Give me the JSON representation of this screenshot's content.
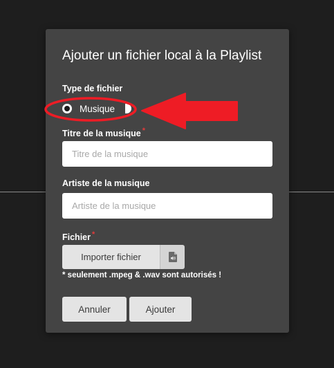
{
  "dialog": {
    "title": "Ajouter un fichier local à la Playlist",
    "file_type": {
      "label": "Type de fichier",
      "options": [
        {
          "label": "Musique",
          "selected": true
        },
        {
          "label": "",
          "selected": false
        }
      ]
    },
    "music_title": {
      "label": "Titre de la musique",
      "required_mark": "*",
      "placeholder": "Titre de la musique",
      "value": ""
    },
    "music_artist": {
      "label": "Artiste de la musique",
      "placeholder": "Artiste de la musique",
      "value": ""
    },
    "file": {
      "label": "Fichier",
      "required_mark": "*",
      "import_label": "Importer fichier",
      "icon": "audio-file-icon",
      "note": "* seulement .mpeg & .wav sont autorisés !"
    },
    "actions": {
      "cancel_label": "Annuler",
      "add_label": "Ajouter"
    }
  },
  "annotation": {
    "color": "#ee1c25",
    "ellipse": "highlight-ellipse",
    "arrow": "pointer-arrow"
  }
}
